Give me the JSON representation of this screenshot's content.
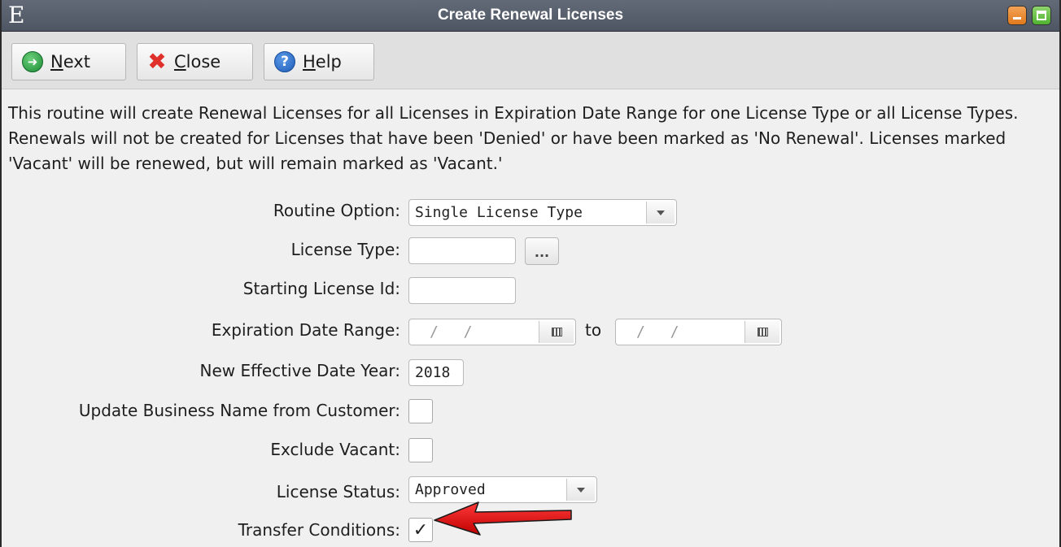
{
  "window": {
    "app_logo": "E",
    "title": "Create Renewal Licenses"
  },
  "toolbar": {
    "next_label": "Next",
    "close_label": "Close",
    "help_label": "Help"
  },
  "description": "This routine will create Renewal Licenses for all Licenses in Expiration Date Range for one License Type or all License Types.  Renewals will not be created for Licenses that have been 'Denied' or have been marked as 'No Renewal'. Licenses marked 'Vacant' will be renewed, but will remain marked as 'Vacant.'",
  "form": {
    "routine_option": {
      "label": "Routine Option:",
      "value": "Single License Type"
    },
    "license_type": {
      "label": "License Type:",
      "value": "",
      "lookup_label": "..."
    },
    "starting_license_id": {
      "label": "Starting License Id:",
      "value": ""
    },
    "expiration_date_range": {
      "label": "Expiration Date Range:",
      "from_value": "/ /",
      "to_label": "to",
      "to_value": "/ /"
    },
    "new_effective_date_year": {
      "label": "New Effective Date Year:",
      "value": "2018"
    },
    "update_business_name": {
      "label": "Update Business Name from Customer:",
      "checked": false
    },
    "exclude_vacant": {
      "label": "Exclude Vacant:",
      "checked": false
    },
    "license_status": {
      "label": "License Status:",
      "value": "Approved"
    },
    "transfer_conditions": {
      "label": "Transfer Conditions:",
      "checked": true,
      "check_mark": "✓"
    }
  },
  "annotation": {
    "arrow_color": "#e01010"
  }
}
